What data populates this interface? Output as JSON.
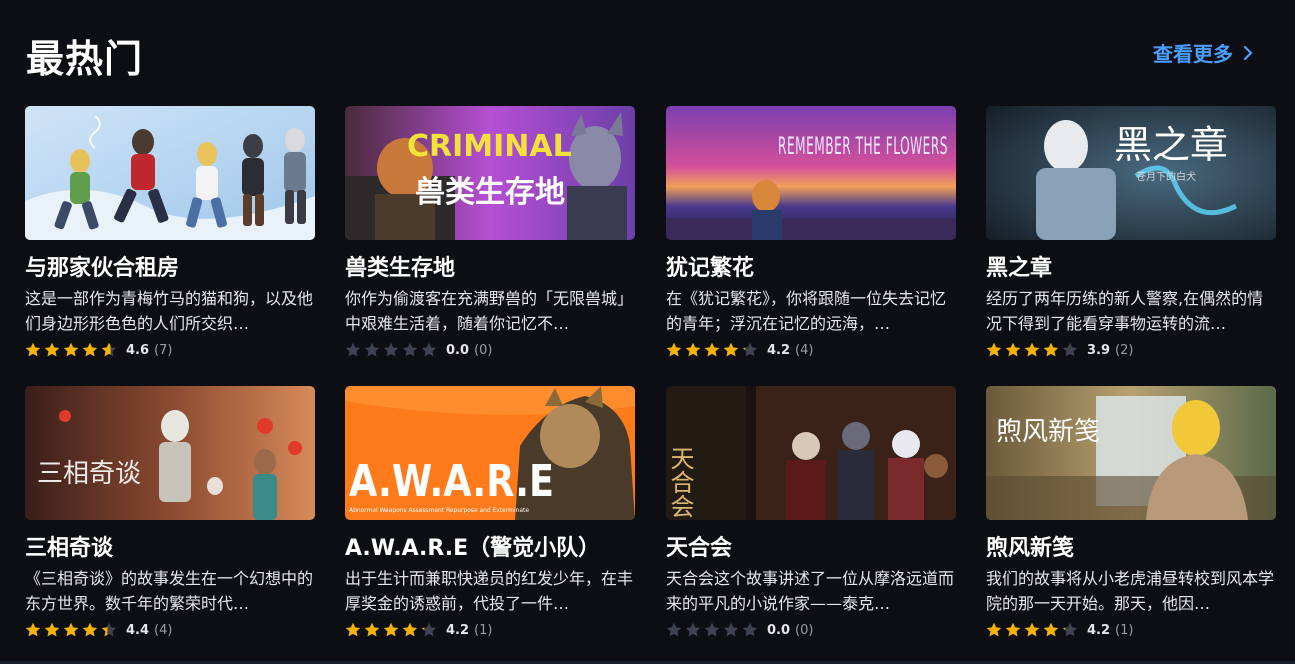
{
  "section": {
    "title": "最热门",
    "more_label": "查看更多"
  },
  "colors": {
    "background": "#0d0e14",
    "accent": "#4a9eff",
    "star_filled": "#f5b301",
    "star_empty": "#3f4352"
  },
  "games": [
    {
      "title": "与那家伙合租房",
      "description": "这是一部作为青梅竹马的猫和狗，以及他们身边形形色色的人们所交织…",
      "rating": 4.6,
      "rating_display": "4.6",
      "count_display": "(7)"
    },
    {
      "title": "兽类生存地",
      "description": "你作为偷渡客在充满野兽的「无限兽城」中艰难生活着，随着你记忆不…",
      "rating": 0.0,
      "rating_display": "0.0",
      "count_display": "(0)",
      "cover_text": [
        "CRIMINAL",
        "兽类生存地"
      ]
    },
    {
      "title": "犹记繁花",
      "description": "在《犹记繁花》，你将跟随一位失去记忆的青年；浮沉在记忆的远海，…",
      "rating": 4.2,
      "rating_display": "4.2",
      "count_display": "(4)",
      "cover_text": [
        "REMEMBER THE FLOWERS"
      ]
    },
    {
      "title": "黑之章",
      "description": "经历了两年历练的新人警察,在偶然的情况下得到了能看穿事物运转的流…",
      "rating": 3.9,
      "rating_display": "3.9",
      "count_display": "(2)",
      "cover_text": [
        "黑之章",
        "苍月下的白犬"
      ]
    },
    {
      "title": "三相奇谈",
      "description": "《三相奇谈》的故事发生在一个幻想中的东方世界。数千年的繁荣时代…",
      "rating": 4.4,
      "rating_display": "4.4",
      "count_display": "(4)",
      "cover_text": [
        "三相奇谈"
      ]
    },
    {
      "title": "A.W.A.R.E（警觉小队）",
      "description": "出于生计而兼职快递员的红发少年，在丰厚奖金的诱惑前，代投了一件…",
      "rating": 4.2,
      "rating_display": "4.2",
      "count_display": "(1)",
      "cover_text": [
        "A.W.A.R.E",
        "Abnormal Weapons Assessment Repurpose and Exterminate"
      ]
    },
    {
      "title": "天合会",
      "description": "天合会这个故事讲述了一位从摩洛远道而来的平凡的小说作家——泰克…",
      "rating": 0.0,
      "rating_display": "0.0",
      "count_display": "(0)",
      "cover_text": [
        "天合会"
      ]
    },
    {
      "title": "煦风新笺",
      "description": "我们的故事将从小老虎浦昼转校到风本学院的那一天开始。那天，他因…",
      "rating": 4.2,
      "rating_display": "4.2",
      "count_display": "(1)",
      "cover_text": [
        "煦风新笺"
      ]
    }
  ]
}
